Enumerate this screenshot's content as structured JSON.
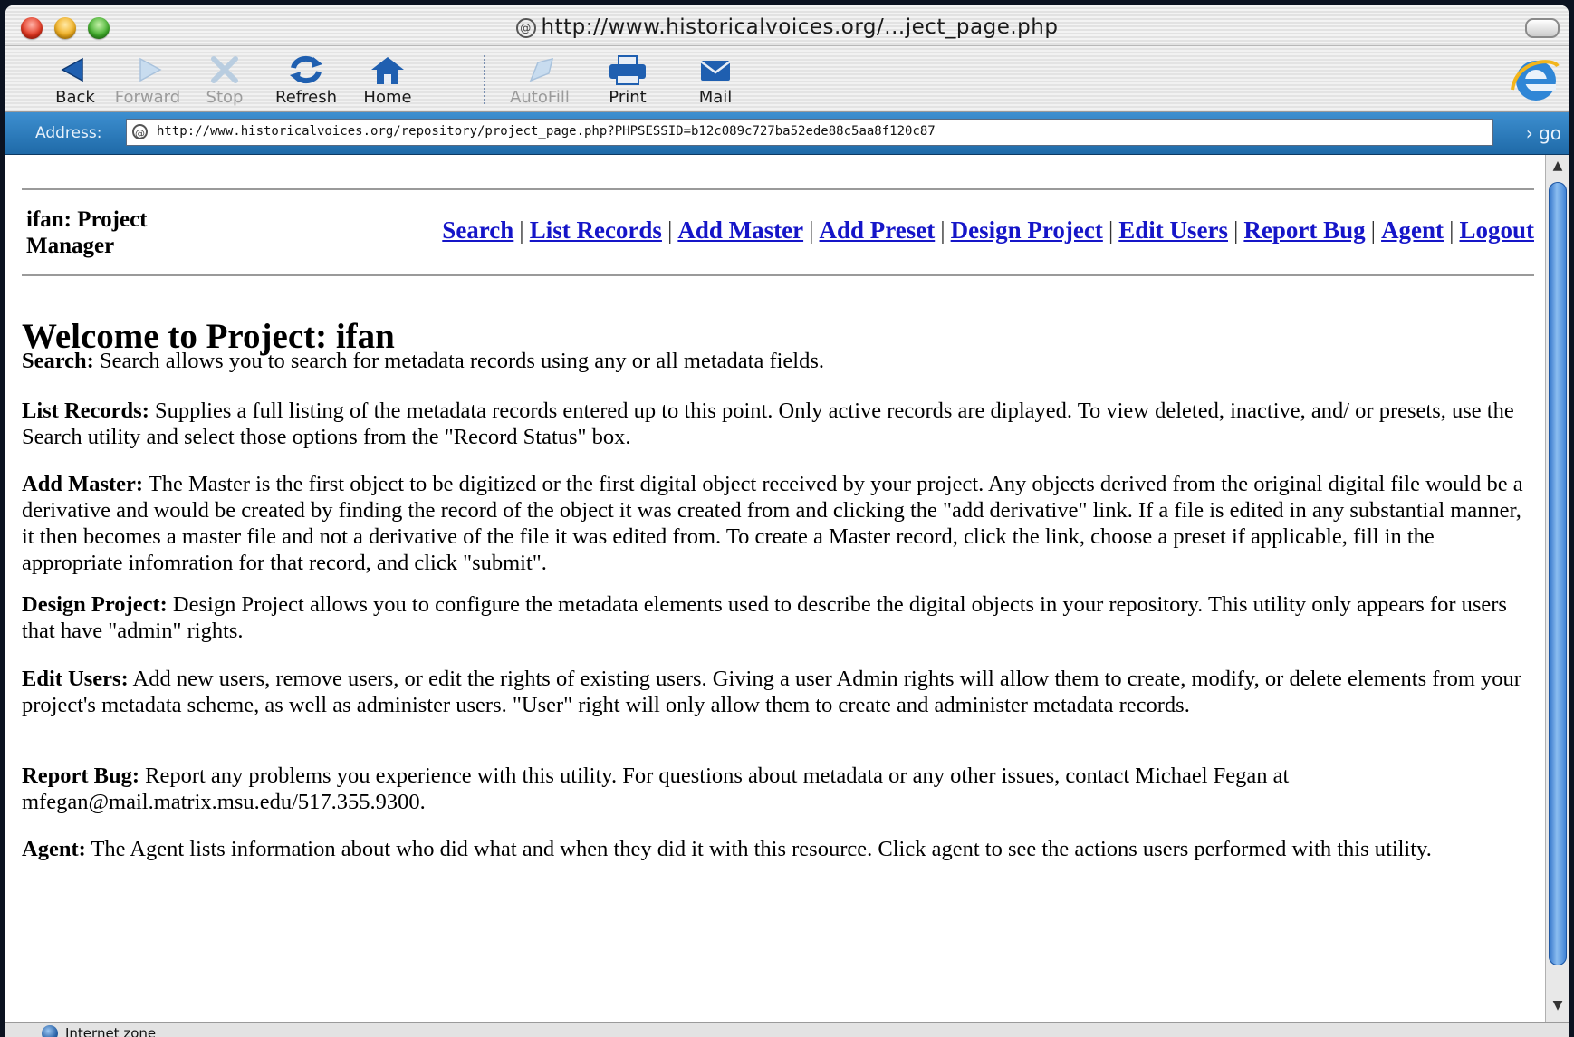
{
  "window": {
    "title": "http://www.historicalvoices.org/...ject_page.php"
  },
  "toolbar": {
    "buttons": [
      {
        "label": "Back",
        "icon": "back-arrow-icon",
        "enabled": true
      },
      {
        "label": "Forward",
        "icon": "forward-arrow-icon",
        "enabled": false
      },
      {
        "label": "Stop",
        "icon": "stop-x-icon",
        "enabled": false
      },
      {
        "label": "Refresh",
        "icon": "refresh-icon",
        "enabled": true
      },
      {
        "label": "Home",
        "icon": "home-icon",
        "enabled": true
      },
      {
        "label": "AutoFill",
        "icon": "autofill-icon",
        "enabled": false
      },
      {
        "label": "Print",
        "icon": "printer-icon",
        "enabled": true
      },
      {
        "label": "Mail",
        "icon": "mail-icon",
        "enabled": true
      }
    ]
  },
  "address": {
    "label": "Address:",
    "url": "http://www.historicalvoices.org/repository/project_page.php?PHPSESSID=b12c089c727ba52ede88c5aa8f120c87",
    "go_label": "go"
  },
  "page": {
    "project_title": "ifan: Project Manager",
    "nav": [
      "Search",
      "List Records",
      "Add Master",
      "Add Preset",
      "Design Project",
      "Edit Users",
      "Report Bug",
      "Agent",
      "Logout"
    ],
    "welcome": "Welcome to Project: ifan",
    "descriptions": [
      {
        "term": "Search:",
        "text": " Search allows you to search for metadata records using any or all metadata fields."
      },
      {
        "term": "List Records:",
        "text": " Supplies a full listing of the metadata records entered up to this point. Only active records are diplayed. To view deleted, inactive, and/ or presets, use the Search utility and select those options from the \"Record Status\" box."
      },
      {
        "term": "Add Master:",
        "text": " The Master is the first object to be digitized or the first digital object received by your project. Any objects derived from the original digital file would be a derivative and would be created by finding the record of the object it was created from and clicking the \"add derivative\" link. If a file is edited in any substantial manner, it then becomes a master file and not a derivative of the file it was edited from. To create a Master record, click the link, choose a preset if applicable, fill in the appropriate infomration for that record, and click \"submit\"."
      },
      {
        "term": "Design Project:",
        "text": " Design Project allows you to configure the metadata elements used to describe the digital objects in your repository. This utility only appears for users that have \"admin\" rights."
      },
      {
        "term": "Edit Users:",
        "text": " Add new users, remove users, or edit the rights of existing users. Giving a user Admin rights will allow them to create, modify, or delete elements from your project's metadata scheme, as well as administer users. \"User\" right will only allow them to create and administer metadata records."
      },
      {
        "term": "Report Bug:",
        "text": " Report any problems you experience with this utility. For questions about metadata or any other issues, contact Michael Fegan at mfegan@mail.matrix.msu.edu/517.355.9300."
      },
      {
        "term": "Agent:",
        "text": " The Agent lists information about who did what and when they did it with this resource. Click agent to see the actions users performed with this utility."
      }
    ]
  },
  "status": {
    "zone": "Internet zone"
  },
  "colors": {
    "link": "#1515c8",
    "address_bar": "#2a78bb"
  }
}
